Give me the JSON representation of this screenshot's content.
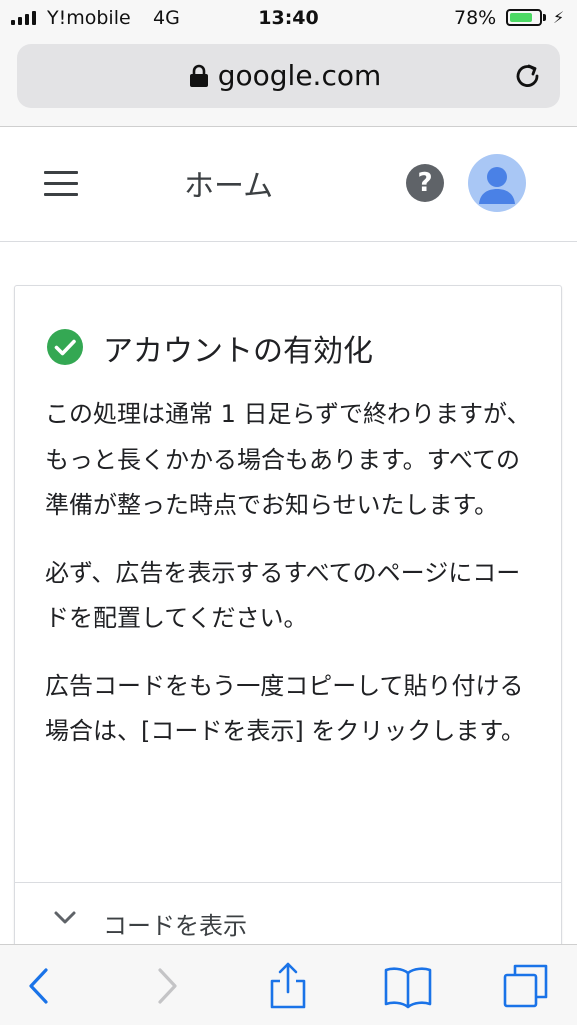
{
  "status_bar": {
    "carrier": "Y!mobile",
    "network": "4G",
    "time": "13:40",
    "battery_percent": "78%",
    "battery_level": 0.78
  },
  "browser": {
    "url": "google.com"
  },
  "app_header": {
    "title": "ホーム"
  },
  "card": {
    "title": "アカウントの有効化",
    "paragraphs": [
      "この処理は通常 1 日足らずで終わりますが、もっと長くかかる場合もあります。すべての準備が整った時点でお知らせいたします。",
      "必ず、広告を表示するすべてのページにコードを配置してください。",
      "広告コードをもう一度コピーして貼り付ける場合は、[コードを表示] をクリックします。"
    ],
    "show_code_label": "コードを表示"
  },
  "colors": {
    "success": "#34a853",
    "icon_gray": "#5f6368",
    "ios_blue": "#1a73e8",
    "avatar_bg": "#a9c7f5",
    "avatar_fg": "#4a81e6"
  }
}
